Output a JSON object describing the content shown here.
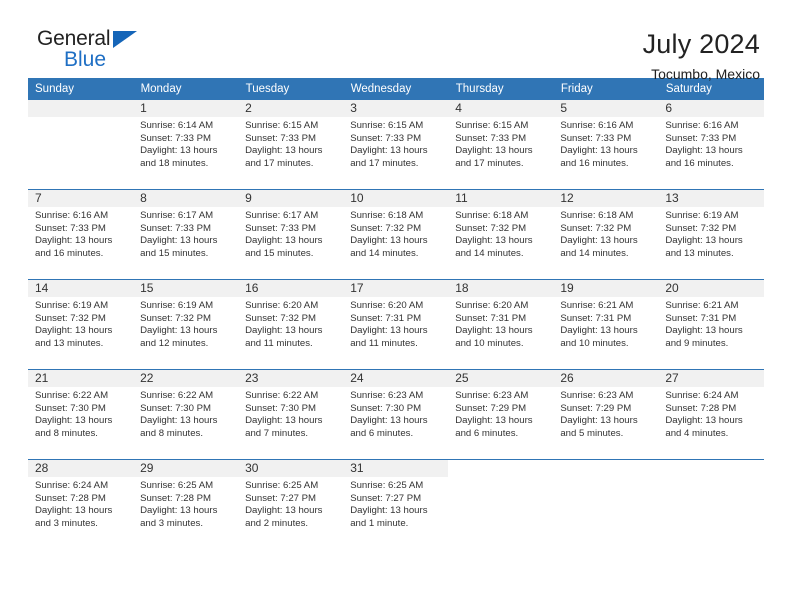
{
  "brand": {
    "name_top": "General",
    "name_bottom": "Blue",
    "triangle_color": "#1565b8",
    "blue_color": "#1f6fc4"
  },
  "header": {
    "title": "July 2024",
    "subtitle": "Tocumbo, Mexico"
  },
  "theme": {
    "header_bg": "#3075b5",
    "daynum_bg": "#f1f1f1",
    "grid_line": "#3075b5"
  },
  "weekday_headers": [
    "Sunday",
    "Monday",
    "Tuesday",
    "Wednesday",
    "Thursday",
    "Friday",
    "Saturday"
  ],
  "weeks": [
    [
      {
        "day": "",
        "sunrise": "",
        "sunset": "",
        "daylight": "",
        "blank": true
      },
      {
        "day": "1",
        "sunrise": "Sunrise: 6:14 AM",
        "sunset": "Sunset: 7:33 PM",
        "daylight": "Daylight: 13 hours and 18 minutes."
      },
      {
        "day": "2",
        "sunrise": "Sunrise: 6:15 AM",
        "sunset": "Sunset: 7:33 PM",
        "daylight": "Daylight: 13 hours and 17 minutes."
      },
      {
        "day": "3",
        "sunrise": "Sunrise: 6:15 AM",
        "sunset": "Sunset: 7:33 PM",
        "daylight": "Daylight: 13 hours and 17 minutes."
      },
      {
        "day": "4",
        "sunrise": "Sunrise: 6:15 AM",
        "sunset": "Sunset: 7:33 PM",
        "daylight": "Daylight: 13 hours and 17 minutes."
      },
      {
        "day": "5",
        "sunrise": "Sunrise: 6:16 AM",
        "sunset": "Sunset: 7:33 PM",
        "daylight": "Daylight: 13 hours and 16 minutes."
      },
      {
        "day": "6",
        "sunrise": "Sunrise: 6:16 AM",
        "sunset": "Sunset: 7:33 PM",
        "daylight": "Daylight: 13 hours and 16 minutes."
      }
    ],
    [
      {
        "day": "7",
        "sunrise": "Sunrise: 6:16 AM",
        "sunset": "Sunset: 7:33 PM",
        "daylight": "Daylight: 13 hours and 16 minutes."
      },
      {
        "day": "8",
        "sunrise": "Sunrise: 6:17 AM",
        "sunset": "Sunset: 7:33 PM",
        "daylight": "Daylight: 13 hours and 15 minutes."
      },
      {
        "day": "9",
        "sunrise": "Sunrise: 6:17 AM",
        "sunset": "Sunset: 7:33 PM",
        "daylight": "Daylight: 13 hours and 15 minutes."
      },
      {
        "day": "10",
        "sunrise": "Sunrise: 6:18 AM",
        "sunset": "Sunset: 7:32 PM",
        "daylight": "Daylight: 13 hours and 14 minutes."
      },
      {
        "day": "11",
        "sunrise": "Sunrise: 6:18 AM",
        "sunset": "Sunset: 7:32 PM",
        "daylight": "Daylight: 13 hours and 14 minutes."
      },
      {
        "day": "12",
        "sunrise": "Sunrise: 6:18 AM",
        "sunset": "Sunset: 7:32 PM",
        "daylight": "Daylight: 13 hours and 14 minutes."
      },
      {
        "day": "13",
        "sunrise": "Sunrise: 6:19 AM",
        "sunset": "Sunset: 7:32 PM",
        "daylight": "Daylight: 13 hours and 13 minutes."
      }
    ],
    [
      {
        "day": "14",
        "sunrise": "Sunrise: 6:19 AM",
        "sunset": "Sunset: 7:32 PM",
        "daylight": "Daylight: 13 hours and 13 minutes."
      },
      {
        "day": "15",
        "sunrise": "Sunrise: 6:19 AM",
        "sunset": "Sunset: 7:32 PM",
        "daylight": "Daylight: 13 hours and 12 minutes."
      },
      {
        "day": "16",
        "sunrise": "Sunrise: 6:20 AM",
        "sunset": "Sunset: 7:32 PM",
        "daylight": "Daylight: 13 hours and 11 minutes."
      },
      {
        "day": "17",
        "sunrise": "Sunrise: 6:20 AM",
        "sunset": "Sunset: 7:31 PM",
        "daylight": "Daylight: 13 hours and 11 minutes."
      },
      {
        "day": "18",
        "sunrise": "Sunrise: 6:20 AM",
        "sunset": "Sunset: 7:31 PM",
        "daylight": "Daylight: 13 hours and 10 minutes."
      },
      {
        "day": "19",
        "sunrise": "Sunrise: 6:21 AM",
        "sunset": "Sunset: 7:31 PM",
        "daylight": "Daylight: 13 hours and 10 minutes."
      },
      {
        "day": "20",
        "sunrise": "Sunrise: 6:21 AM",
        "sunset": "Sunset: 7:31 PM",
        "daylight": "Daylight: 13 hours and 9 minutes."
      }
    ],
    [
      {
        "day": "21",
        "sunrise": "Sunrise: 6:22 AM",
        "sunset": "Sunset: 7:30 PM",
        "daylight": "Daylight: 13 hours and 8 minutes."
      },
      {
        "day": "22",
        "sunrise": "Sunrise: 6:22 AM",
        "sunset": "Sunset: 7:30 PM",
        "daylight": "Daylight: 13 hours and 8 minutes."
      },
      {
        "day": "23",
        "sunrise": "Sunrise: 6:22 AM",
        "sunset": "Sunset: 7:30 PM",
        "daylight": "Daylight: 13 hours and 7 minutes."
      },
      {
        "day": "24",
        "sunrise": "Sunrise: 6:23 AM",
        "sunset": "Sunset: 7:30 PM",
        "daylight": "Daylight: 13 hours and 6 minutes."
      },
      {
        "day": "25",
        "sunrise": "Sunrise: 6:23 AM",
        "sunset": "Sunset: 7:29 PM",
        "daylight": "Daylight: 13 hours and 6 minutes."
      },
      {
        "day": "26",
        "sunrise": "Sunrise: 6:23 AM",
        "sunset": "Sunset: 7:29 PM",
        "daylight": "Daylight: 13 hours and 5 minutes."
      },
      {
        "day": "27",
        "sunrise": "Sunrise: 6:24 AM",
        "sunset": "Sunset: 7:28 PM",
        "daylight": "Daylight: 13 hours and 4 minutes."
      }
    ],
    [
      {
        "day": "28",
        "sunrise": "Sunrise: 6:24 AM",
        "sunset": "Sunset: 7:28 PM",
        "daylight": "Daylight: 13 hours and 3 minutes."
      },
      {
        "day": "29",
        "sunrise": "Sunrise: 6:25 AM",
        "sunset": "Sunset: 7:28 PM",
        "daylight": "Daylight: 13 hours and 3 minutes."
      },
      {
        "day": "30",
        "sunrise": "Sunrise: 6:25 AM",
        "sunset": "Sunset: 7:27 PM",
        "daylight": "Daylight: 13 hours and 2 minutes."
      },
      {
        "day": "31",
        "sunrise": "Sunrise: 6:25 AM",
        "sunset": "Sunset: 7:27 PM",
        "daylight": "Daylight: 13 hours and 1 minute."
      },
      {
        "day": "",
        "sunrise": "",
        "sunset": "",
        "daylight": "",
        "blank": true,
        "empty": true
      },
      {
        "day": "",
        "sunrise": "",
        "sunset": "",
        "daylight": "",
        "blank": true,
        "empty": true
      },
      {
        "day": "",
        "sunrise": "",
        "sunset": "",
        "daylight": "",
        "blank": true,
        "empty": true
      }
    ]
  ]
}
